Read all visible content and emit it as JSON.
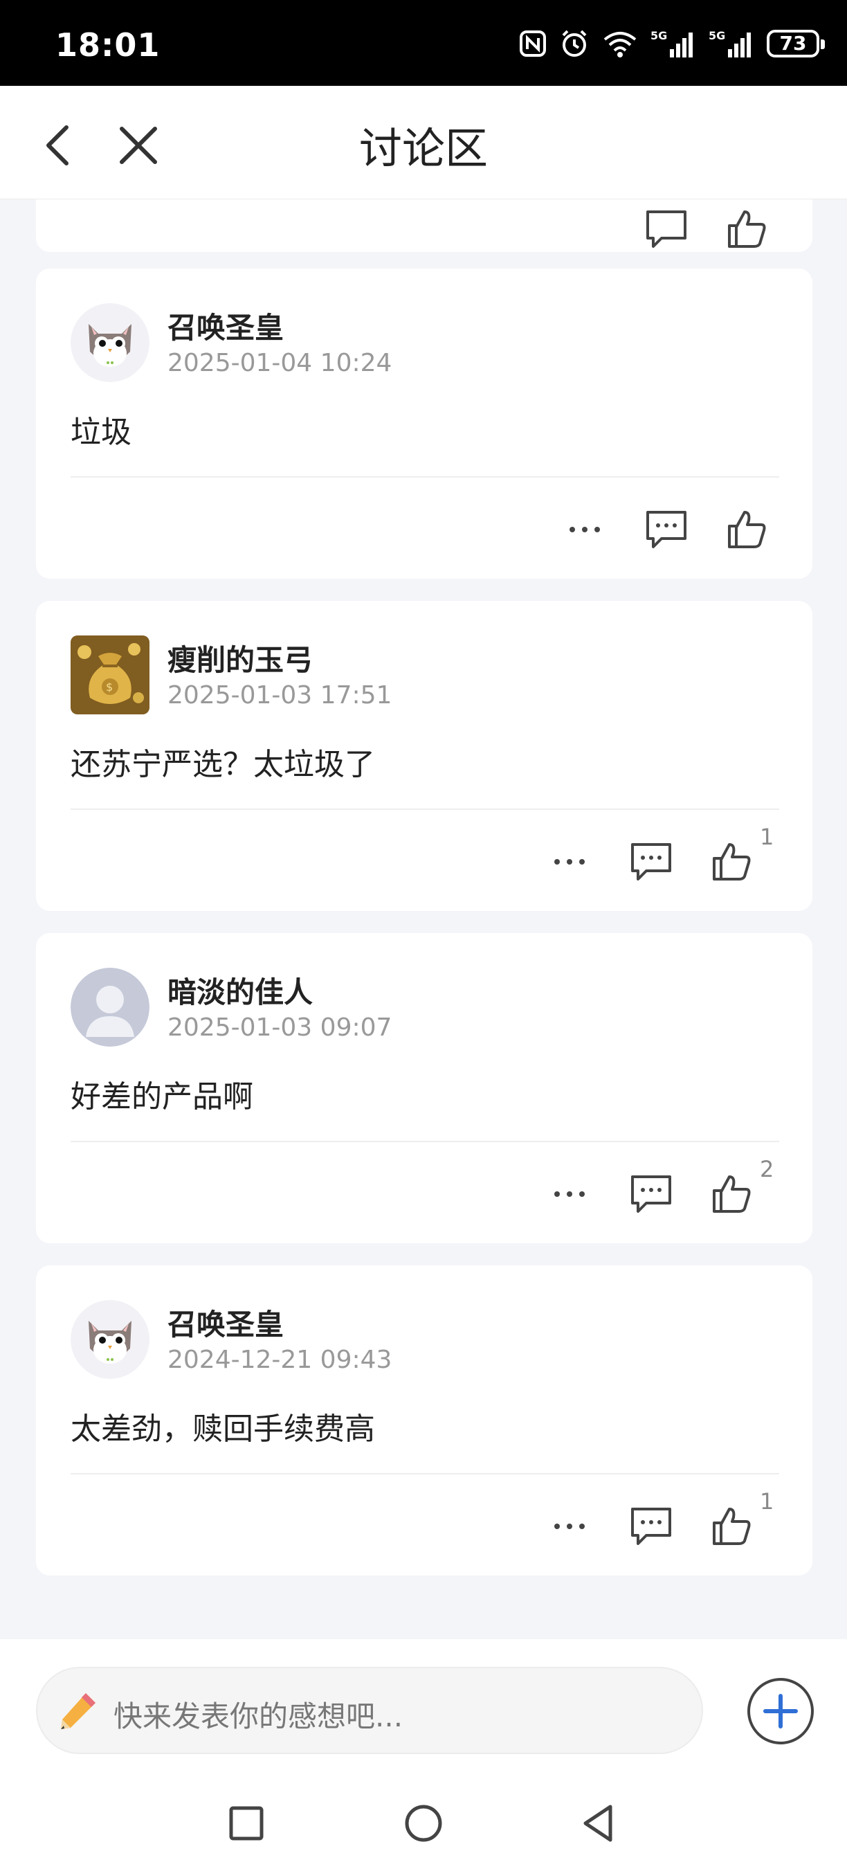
{
  "status_bar": {
    "time": "18:01",
    "battery": "73",
    "icons": [
      "nfc-icon",
      "alarm-icon",
      "wifi-icon",
      "signal-5g-icon",
      "signal-5g-icon",
      "battery-icon"
    ]
  },
  "header": {
    "title": "讨论区",
    "back_icon": "chevron-left-icon",
    "close_icon": "close-icon"
  },
  "posts": [
    {
      "username": "召唤圣皇",
      "timestamp": "2025-01-04 10:24",
      "content": "垃圾",
      "likes": "",
      "avatar": "owl-avatar"
    },
    {
      "username": "瘦削的玉弓",
      "timestamp": "2025-01-03 17:51",
      "content": "还苏宁严选？太垃圾了",
      "likes": "1",
      "avatar": "gold-bag-avatar"
    },
    {
      "username": "暗淡的佳人",
      "timestamp": "2025-01-03 09:07",
      "content": "好差的产品啊",
      "likes": "2",
      "avatar": "default-person-avatar"
    },
    {
      "username": "召唤圣皇",
      "timestamp": "2024-12-21 09:43",
      "content": "太差劲，赎回手续费高",
      "likes": "1",
      "avatar": "owl-avatar"
    }
  ],
  "comment_bar": {
    "placeholder": "快来发表你的感想吧..."
  },
  "colors": {
    "background": "#f4f5f9",
    "card": "#ffffff",
    "status_bar": "#000000",
    "text_primary": "#222222",
    "text_secondary": "#999999",
    "icon": "#444444",
    "accent": "#2f6fd6"
  }
}
